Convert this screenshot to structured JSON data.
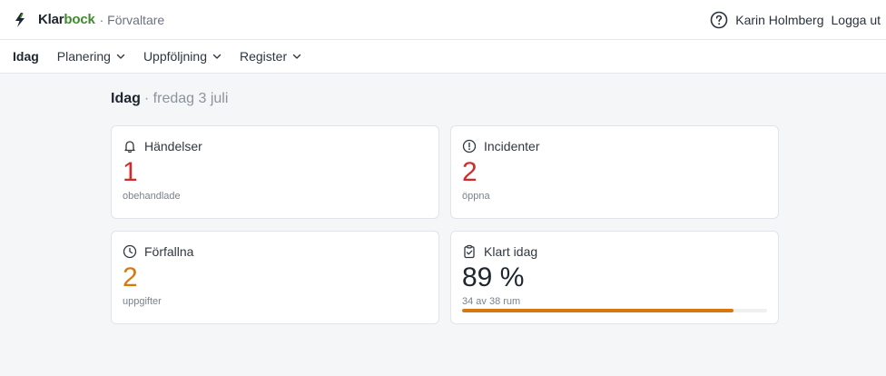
{
  "header": {
    "brand_part1": "Klar",
    "brand_part2": "bock",
    "role": "· Förvaltare",
    "user_name": "Karin Holmberg",
    "logout_label": "Logga ut"
  },
  "nav": {
    "items": [
      {
        "label": "Idag",
        "active": true,
        "dropdown": false
      },
      {
        "label": "Planering",
        "active": false,
        "dropdown": true
      },
      {
        "label": "Uppföljning",
        "active": false,
        "dropdown": true
      },
      {
        "label": "Register",
        "active": false,
        "dropdown": true
      }
    ]
  },
  "page": {
    "title": "Idag",
    "subtitle": "· fredag 3 juli"
  },
  "cards": [
    {
      "label": "Händelser",
      "value": "1",
      "sub": "obehandlade",
      "icon": "bell-icon",
      "value_color": "#d22b2b"
    },
    {
      "label": "Incidenter",
      "value": "2",
      "sub": "öppna",
      "icon": "alert-circle-icon",
      "value_color": "#d22b2b"
    },
    {
      "label": "Förfallna",
      "value": "2",
      "sub": "uppgifter",
      "icon": "clock-icon",
      "value_color": "#d9770f"
    },
    {
      "label": "Klart idag",
      "value": "89 %",
      "sub": "34 av 38 rum",
      "icon": "clipboard-check-icon",
      "value_color": "#1e2630",
      "progress": 0.89
    }
  ],
  "colors": {
    "accent_green": "#3e8a2c",
    "danger": "#d22b2b",
    "warning": "#d9770f",
    "progress_fill": "#d9770f"
  }
}
